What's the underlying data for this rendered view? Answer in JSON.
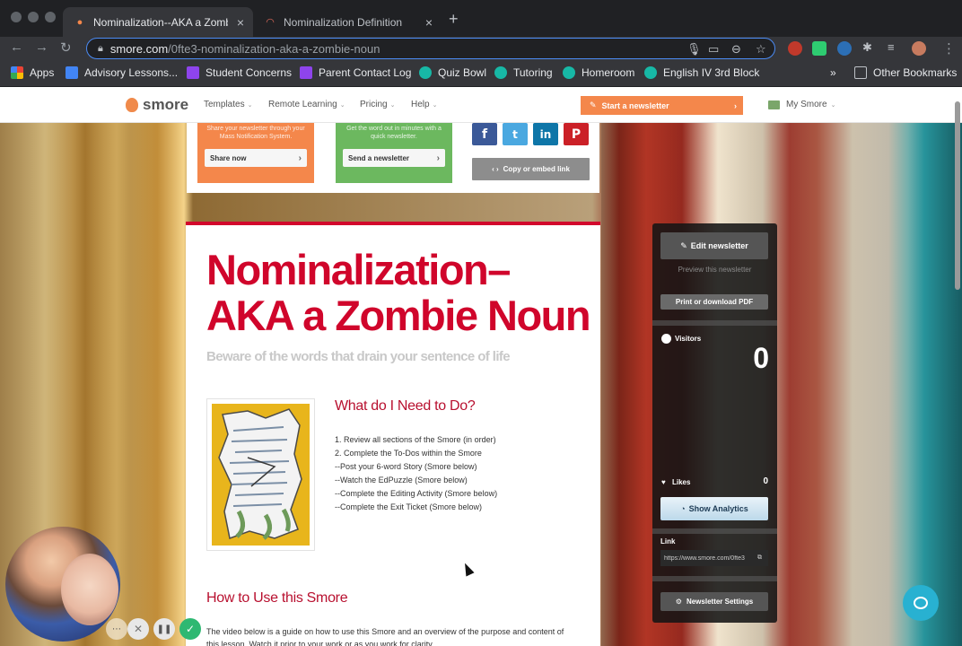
{
  "browser": {
    "tabs": [
      {
        "title": "Nominalization--AKA a Zombie Noun"
      },
      {
        "title": "Nominalization Definition"
      }
    ],
    "url_host": "smore.com",
    "url_path": "/0fte3-nominalization-aka-a-zombie-noun",
    "bookmarks": [
      {
        "label": "Apps",
        "color": "#ea4335"
      },
      {
        "label": "Advisory Lessons...",
        "color": "#4285f4"
      },
      {
        "label": "Student Concerns",
        "color": "#8e44ec"
      },
      {
        "label": "Parent Contact Log",
        "color": "#8e44ec"
      },
      {
        "label": "Quiz Bowl",
        "color": "#17b8a6"
      },
      {
        "label": "Tutoring",
        "color": "#17b8a6"
      },
      {
        "label": "Homeroom",
        "color": "#17b8a6"
      },
      {
        "label": "English IV 3rd Block",
        "color": "#17b8a6"
      }
    ],
    "bookmarks_overflow": "»",
    "other_bookmarks": "Other Bookmarks"
  },
  "smore_nav": {
    "logo": "smore",
    "items": [
      "Templates",
      "Remote Learning",
      "Pricing",
      "Help"
    ],
    "start_button": "Start a newsletter",
    "my_smore": "My Smore"
  },
  "share": {
    "card1_desc": "Share your newsletter through your Mass Notification System.",
    "card1_button": "Share now",
    "card2_desc": "Get the word out in minutes with a quick newsletter.",
    "card2_button": "Send a newsletter",
    "social": [
      "f",
      "t",
      "in",
      "P"
    ],
    "copy_link": "Copy or embed link"
  },
  "newsletter": {
    "title": "Nominalization–AKA a Zombie Noun",
    "subtitle": "Beware of the words that drain your sentence of life",
    "section1_title": "What do I Need to Do?",
    "section1_items": [
      "1. Review all sections of the Smore (in order)",
      "2. Complete the To-Dos within the Smore",
      "--Post your 6-word Story (Smore below)",
      "--Watch the EdPuzzle (Smore below)",
      "--Complete the Editing Activity (Smore below)",
      "--Complete the Exit Ticket (Smore below)"
    ],
    "section2_title": "How to Use this Smore",
    "section2_text": "The video below is a guide on how to use this Smore and an overview of the purpose and content of this lesson. Watch it prior to your work or as you work for clarity."
  },
  "side_panel": {
    "edit": "Edit newsletter",
    "preview": "Preview this newsletter",
    "print": "Print or download PDF",
    "visitors_label": "Visitors",
    "visitors_count": "0",
    "likes_label": "Likes",
    "likes_count": "0",
    "analytics": "Show Analytics",
    "link_label": "Link",
    "link_url": "https://www.smore.com/0fte3",
    "settings": "Newsletter Settings"
  },
  "colors": {
    "accent_red": "#d0052b",
    "smore_orange": "#f4874b",
    "share_green": "#6cb85f",
    "help_blue": "#28b1d1"
  }
}
